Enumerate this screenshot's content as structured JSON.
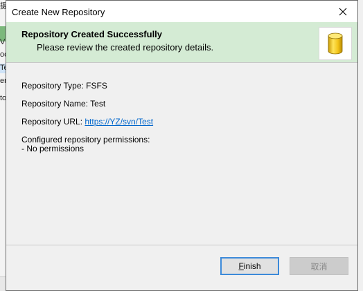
{
  "background_app": {
    "text_lines": [
      "摄",
      "V",
      "oc",
      "Te",
      "er",
      "to"
    ]
  },
  "dialog": {
    "title": "Create New Repository",
    "close_icon": "close-icon",
    "header": {
      "title": "Repository Created Successfully",
      "subtitle": "Please review the created repository details.",
      "icon": "database-icon"
    },
    "details": {
      "type_label": "Repository Type: ",
      "type_value": "FSFS",
      "name_label": "Repository Name: ",
      "name_value": "Test",
      "url_label": "Repository URL: ",
      "url_value": "https://YZ/svn/Test",
      "permissions_label": "Configured repository permissions:",
      "permissions_value": "- No permissions"
    },
    "buttons": {
      "finish_mnemonic": "F",
      "finish_rest": "inish",
      "cancel": "取消"
    },
    "colors": {
      "header_bg": "#d4ebd4",
      "link": "#0066cc",
      "focus_border": "#3c8ad9"
    }
  }
}
